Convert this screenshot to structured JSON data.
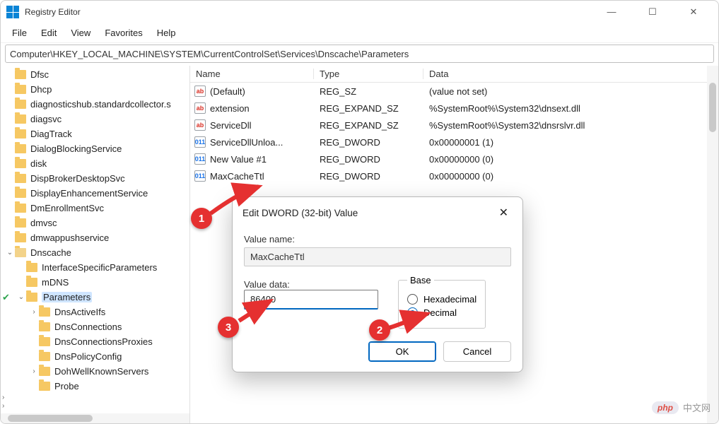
{
  "window": {
    "title": "Registry Editor"
  },
  "menu": {
    "file": "File",
    "edit": "Edit",
    "view": "View",
    "favorites": "Favorites",
    "help": "Help"
  },
  "address": "Computer\\HKEY_LOCAL_MACHINE\\SYSTEM\\CurrentControlSet\\Services\\Dnscache\\Parameters",
  "tree": {
    "items": [
      {
        "label": "Dfsc"
      },
      {
        "label": "Dhcp"
      },
      {
        "label": "diagnosticshub.standardcollector.s"
      },
      {
        "label": "diagsvc"
      },
      {
        "label": "DiagTrack"
      },
      {
        "label": "DialogBlockingService"
      },
      {
        "label": "disk"
      },
      {
        "label": "DispBrokerDesktopSvc"
      },
      {
        "label": "DisplayEnhancementService"
      },
      {
        "label": "DmEnrollmentSvc"
      },
      {
        "label": "dmvsc"
      },
      {
        "label": "dmwappushservice"
      },
      {
        "label": "Dnscache",
        "open": true
      },
      {
        "label": "InterfaceSpecificParameters",
        "indent": 1
      },
      {
        "label": "mDNS",
        "indent": 1
      },
      {
        "label": "Parameters",
        "indent": 1,
        "selected": true,
        "hasCheck": true,
        "expandable": true
      },
      {
        "label": "DnsActiveIfs",
        "indent": 2,
        "chev": true
      },
      {
        "label": "DnsConnections",
        "indent": 2
      },
      {
        "label": "DnsConnectionsProxies",
        "indent": 2
      },
      {
        "label": "DnsPolicyConfig",
        "indent": 2
      },
      {
        "label": "DohWellKnownServers",
        "indent": 2,
        "chev": true
      },
      {
        "label": "Probe",
        "indent": 2
      }
    ]
  },
  "list": {
    "headers": {
      "name": "Name",
      "type": "Type",
      "data": "Data"
    },
    "rows": [
      {
        "icon": "sz",
        "name": "(Default)",
        "type": "REG_SZ",
        "data": "(value not set)"
      },
      {
        "icon": "sz",
        "name": "extension",
        "type": "REG_EXPAND_SZ",
        "data": "%SystemRoot%\\System32\\dnsext.dll"
      },
      {
        "icon": "sz",
        "name": "ServiceDll",
        "type": "REG_EXPAND_SZ",
        "data": "%SystemRoot%\\System32\\dnsrslvr.dll"
      },
      {
        "icon": "dw",
        "name": "ServiceDllUnloa...",
        "type": "REG_DWORD",
        "data": "0x00000001 (1)"
      },
      {
        "icon": "dw",
        "name": "New Value #1",
        "type": "REG_DWORD",
        "data": "0x00000000 (0)"
      },
      {
        "icon": "dw",
        "name": "MaxCacheTtl",
        "type": "REG_DWORD",
        "data": "0x00000000 (0)"
      }
    ]
  },
  "dialog": {
    "title": "Edit DWORD (32-bit) Value",
    "valueNameLabel": "Value name:",
    "valueName": "MaxCacheTtl",
    "valueDataLabel": "Value data:",
    "valueData": "86400",
    "baseLabel": "Base",
    "hex": "Hexadecimal",
    "dec": "Decimal",
    "ok": "OK",
    "cancel": "Cancel"
  },
  "annotations": {
    "m1": "1",
    "m2": "2",
    "m3": "3"
  },
  "watermark": {
    "badge": "php",
    "text": "中文网"
  }
}
